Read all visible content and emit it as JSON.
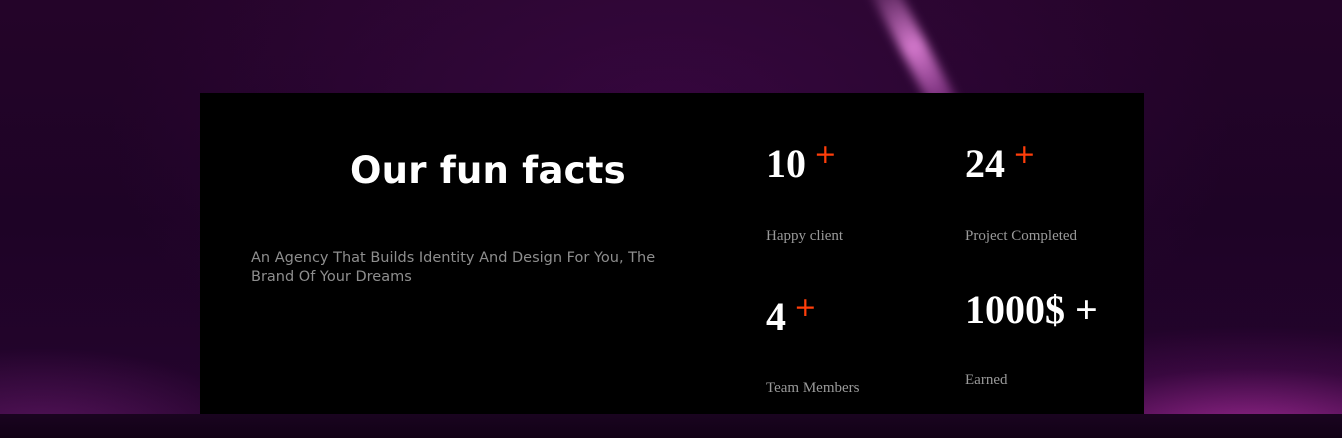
{
  "section": {
    "heading": "Our fun facts",
    "description": "An Agency That Builds Identity And Design For You, The Brand Of Your Dreams"
  },
  "facts": [
    {
      "value": "10",
      "suffix": "+",
      "label": "Happy client",
      "suffix_color": "#ff3e0a"
    },
    {
      "value": "24",
      "suffix": "+",
      "label": "Project Completed",
      "suffix_color": "#ff3e0a"
    },
    {
      "value": "4",
      "suffix": "+",
      "label": "Team Members",
      "suffix_color": "#ff3e0a"
    },
    {
      "value": "1000$",
      "suffix": "+",
      "label": "Earned",
      "suffix_color": "#ffffff"
    }
  ],
  "colors": {
    "accent": "#ff3e0a",
    "card_background": "#000000",
    "page_background": "#1c0323",
    "heading": "#ffffff",
    "muted_text": "#9a9a9a"
  }
}
